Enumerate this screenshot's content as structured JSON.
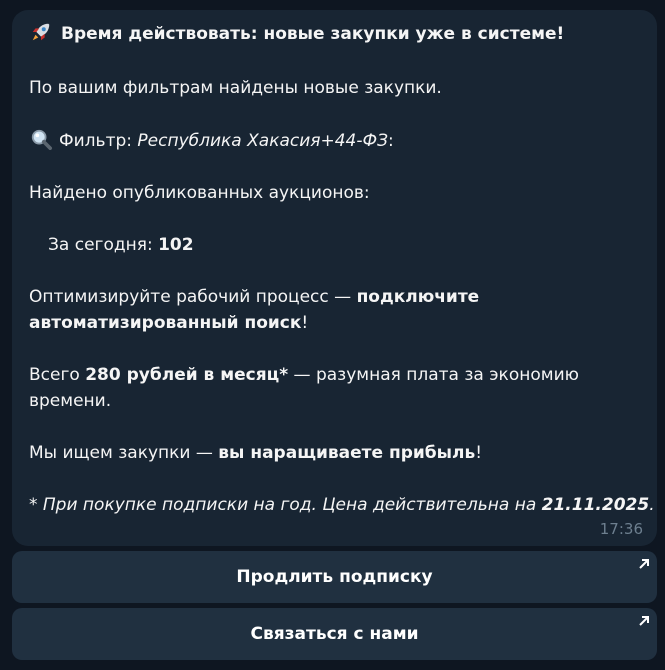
{
  "message": {
    "title": "Время действовать: новые закупки уже в системе!",
    "intro": "По вашим фильтрам найдены новые закупки.",
    "filter_label": "Фильтр: ",
    "filter_value": "Республика Хакасия+44-ФЗ",
    "filter_colon": ":",
    "found_label": "Найдено опубликованных аукционов:",
    "today_label": "За сегодня: ",
    "today_count": "102",
    "optimize_text": "Оптимизируйте рабочий процесс — ",
    "optimize_bold": "подключите автоматизированный поиск",
    "optimize_end": "!",
    "price_prefix": "Всего ",
    "price_bold": "280 рублей в месяц*",
    "price_suffix": " — разумная плата за экономию времени.",
    "search_prefix": "Мы ищем закупки — ",
    "search_bold": "вы наращиваете прибыль",
    "search_end": "!",
    "footnote_prefix": "* При покупке подписки на год. Цена действительна на ",
    "footnote_date": "21.11.2025",
    "footnote_end": ".",
    "time": "17:36"
  },
  "icons": {
    "title_icon": "rocket-icon",
    "filter_icon": "magnifying-glass-icon",
    "button_icon": "arrow-up-right-icon"
  },
  "buttons": {
    "renew": "Продлить подписку",
    "contact": "Связаться с нами"
  },
  "colors": {
    "background": "#0e1621",
    "bubble": "#182533",
    "button": "#203040",
    "time": "#6d7f8f"
  }
}
